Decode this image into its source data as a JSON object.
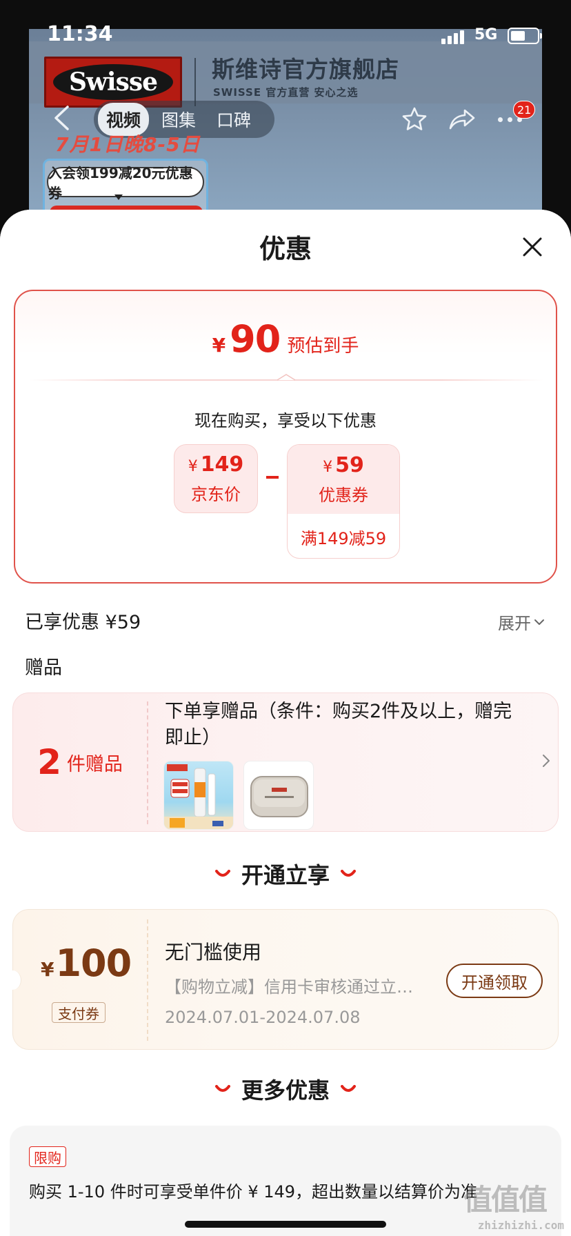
{
  "status_bar": {
    "time": "11:34",
    "network": "5G"
  },
  "store_header": {
    "brand": "Swisse",
    "store_name": "斯维诗官方旗舰店",
    "store_sub": "SWISSE  官方直营 安心之选"
  },
  "nav": {
    "tabs": [
      {
        "label": "视频",
        "active": true
      },
      {
        "label": "图集",
        "active": false
      },
      {
        "label": "口碑",
        "active": false
      }
    ],
    "message_badge": "21"
  },
  "promo_banner": {
    "date_text": "7月1日晚8-5日",
    "member_text": "入会领199减20元优惠券"
  },
  "sheet": {
    "title": "优惠"
  },
  "estimate": {
    "currency": "¥",
    "amount": "90",
    "label": "预估到手",
    "buy_now_text": "现在购买，享受以下优惠",
    "price": {
      "symbol": "¥",
      "value": "149",
      "label": "京东价"
    },
    "coupon": {
      "symbol": "¥",
      "value": "59",
      "label": "优惠券",
      "rule": "满149减59"
    }
  },
  "enjoyed": {
    "text": "已享优惠 ¥59",
    "expand_label": "展开"
  },
  "gifts": {
    "heading": "赠品",
    "count": "2",
    "count_label": "件赠品",
    "condition": "下单享赠品（条件：购买2件及以上，赠完即止）"
  },
  "open_section": {
    "heading": "开通立享",
    "coupon": {
      "symbol": "¥",
      "amount": "100",
      "type": "支付券",
      "title": "无门槛使用",
      "desc": "【购物立减】信用卡审核通过立…",
      "date": "2024.07.01-2024.07.08",
      "button": "开通领取"
    }
  },
  "more_section": {
    "heading": "更多优惠",
    "limit_tag": "限购",
    "limit_text": "购买 1-10 件时可享受单件价 ¥ 149，超出数量以结算价为准"
  },
  "watermark": {
    "big": "值值值",
    "small": "zhizhizhi.com"
  },
  "colors": {
    "accent_red": "#e2231a",
    "brown": "#7b3a14"
  }
}
